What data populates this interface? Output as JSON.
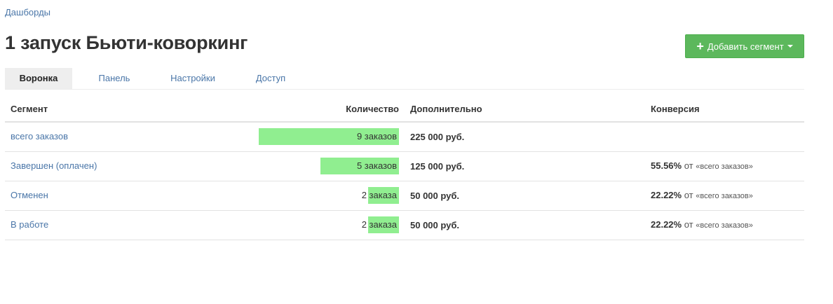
{
  "breadcrumb": "Дашборды",
  "title": "1 запуск Бьюти-коворкинг",
  "add_button": {
    "label": "Добавить сегмент",
    "icon": "plus-icon",
    "dropdown_icon": "caret-down-icon"
  },
  "tabs": [
    {
      "label": "Воронка",
      "active": true
    },
    {
      "label": "Панель",
      "active": false
    },
    {
      "label": "Настройки",
      "active": false
    },
    {
      "label": "Доступ",
      "active": false
    }
  ],
  "table": {
    "headers": {
      "segment": "Сегмент",
      "count": "Количество",
      "extra": "Дополнительно",
      "conversion": "Конверсия"
    },
    "rows": [
      {
        "segment": "всего заказов",
        "count": "9 заказов",
        "fill": 0.833,
        "extra": "225 000 руб.",
        "conversion": null
      },
      {
        "segment": "Завершен (оплачен)",
        "count": "5 заказов",
        "fill": 0.467,
        "extra": "125 000 руб.",
        "conversion": {
          "pct": "55.56%",
          "of": "от",
          "ref": "«всего заказов»"
        }
      },
      {
        "segment": "Отменен",
        "count": "2 заказа",
        "fill": 0.183,
        "extra": "50 000 руб.",
        "conversion": {
          "pct": "22.22%",
          "of": "от",
          "ref": "«всего заказов»"
        }
      },
      {
        "segment": "В работе",
        "count": "2 заказа",
        "fill": 0.183,
        "extra": "50 000 руб.",
        "conversion": {
          "pct": "22.22%",
          "of": "от",
          "ref": "«всего заказов»"
        }
      }
    ]
  },
  "colors": {
    "bar": "#90ee90",
    "primary_button": "#5cb85c",
    "link": "#4a76a8"
  }
}
